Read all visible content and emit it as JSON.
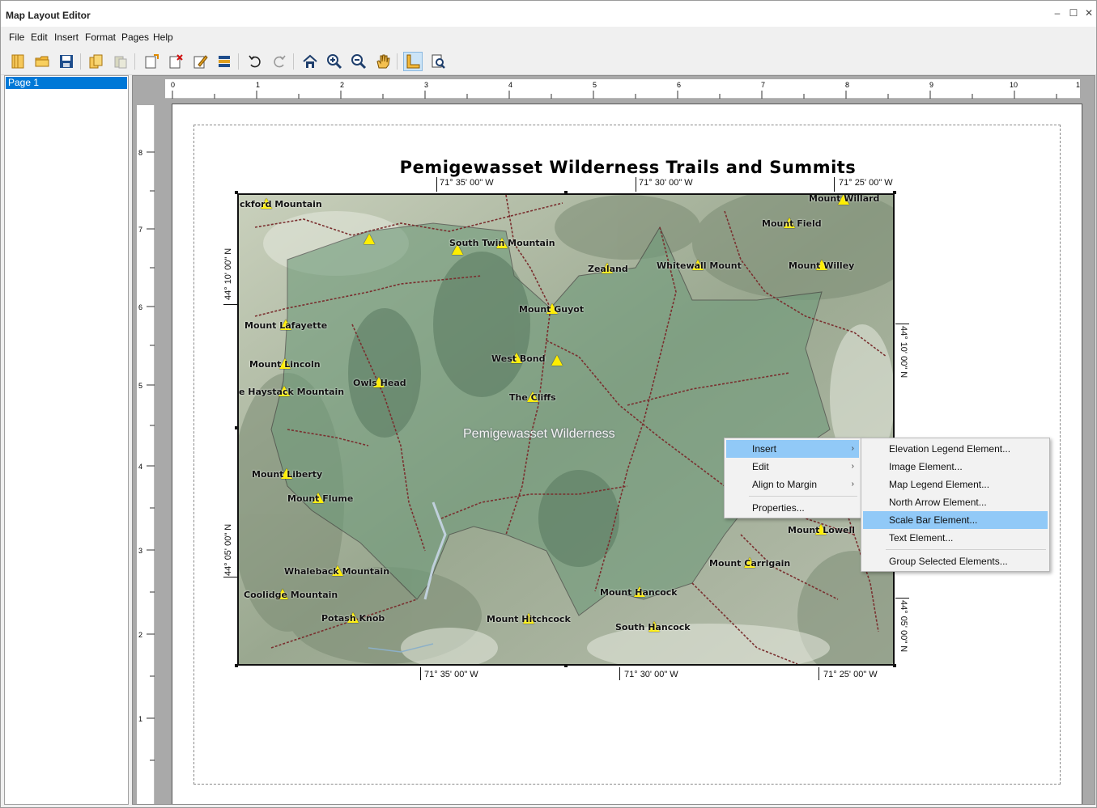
{
  "window": {
    "title": "Map Layout Editor"
  },
  "menu": [
    "File",
    "Edit",
    "Insert",
    "Format",
    "Pages",
    "Help"
  ],
  "pages": {
    "items": [
      "Page 1"
    ]
  },
  "ruler_top": [
    "0",
    "1",
    "2",
    "3",
    "4",
    "5",
    "6",
    "7",
    "8",
    "9",
    "10",
    "1"
  ],
  "ruler_left": [
    "8",
    "7",
    "6",
    "5",
    "4",
    "3",
    "2",
    "1"
  ],
  "map": {
    "title": "Pemigewasset Wilderness Trails and Summits",
    "area_label": "Pemigewasset Wilderness",
    "top_coords": [
      "71° 35' 00\" W",
      "71° 30' 00\" W",
      "71° 25' 00\" W"
    ],
    "bottom_coords": [
      "71° 35' 00\" W",
      "71° 30' 00\" W",
      "71° 25' 00\" W"
    ],
    "left_coords": [
      "44° 10' 00\" N",
      "44° 05' 00\" N"
    ],
    "right_coords": [
      "44° 10' 00\" N",
      "44° 05' 00\" N"
    ],
    "peaks": [
      "ckford Mountain",
      "Mount Willard",
      "Mount Field",
      "South Twin Mountain",
      "Zealand",
      "Whitewall Mount",
      "Mount Willey",
      "Mount Guyot",
      "Mount Lafayette",
      "West Bond",
      "Mount Lincoln",
      "Owls Head",
      "e Haystack Mountain",
      "The Cliffs",
      "Mount Liberty",
      "Mount Flume",
      "Mount Lowell",
      "Mount Carrigain",
      "Whaleback Mountain",
      "Coolidge Mountain",
      "Mount Hancock",
      "Potash Knob",
      "Mount Hitchcock",
      "South Hancock"
    ]
  },
  "context_menu": {
    "items": [
      "Insert",
      "Edit",
      "Align to Margin",
      "Properties..."
    ],
    "submenu": [
      "Elevation Legend Element...",
      "Image Element...",
      "Map Legend Element...",
      "North Arrow Element...",
      "Scale Bar Element...",
      "Text Element...",
      "Group Selected Elements..."
    ]
  },
  "colors": {
    "accent": "#0078d7",
    "highlight": "#91c9f7",
    "peak": "#ffee00"
  }
}
